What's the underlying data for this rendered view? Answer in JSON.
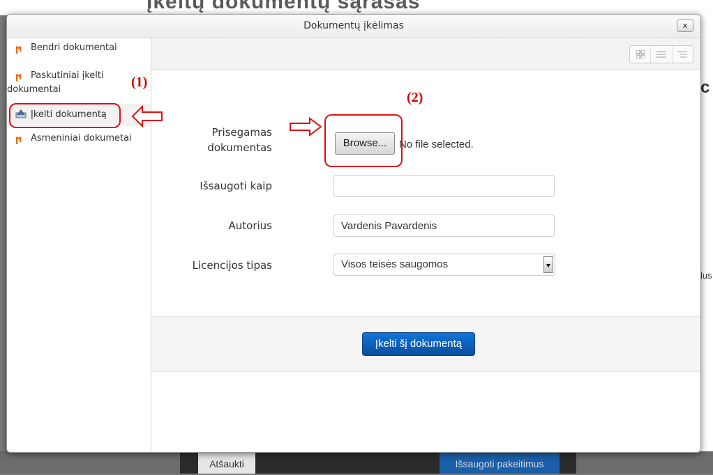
{
  "background": {
    "top_heading": "Įkeltų dokumentų sąrašas",
    "right_fragment_1": "c",
    "right_fragment_2": "lus",
    "cancel_label": "Atšaukti",
    "save_label": "Išsaugoti pakeitimus"
  },
  "modal": {
    "title": "Dokumentų įkėlimas",
    "close_label": "x"
  },
  "sidebar": {
    "items": [
      {
        "label": "Bendri dokumentai",
        "icon": "moodle-icon"
      },
      {
        "label_line1": "Paskutiniai įkelti",
        "label_line2": "dokumentai",
        "icon": "moodle-icon"
      },
      {
        "label": "Įkelti dokumentą",
        "icon": "upload-icon",
        "active": true
      },
      {
        "label": "Asmeniniai dokumetai",
        "icon": "moodle-icon"
      }
    ]
  },
  "form": {
    "attachment_label_line1": "Prisegamas",
    "attachment_label_line2": "dokumentas",
    "browse_label": "Browse...",
    "no_file_text": "No file selected.",
    "save_as_label": "Išsaugoti kaip",
    "save_as_value": "",
    "author_label": "Autorius",
    "author_value": "Vardenis Pavardenis",
    "license_label": "Licencijos tipas",
    "license_value": "Visos teisės saugomos",
    "upload_button": "Įkelti šį dokumentą"
  },
  "annotations": {
    "marker_1": "(1)",
    "marker_2": "(2)",
    "color": "#cc0000"
  },
  "colors": {
    "primary_button": "#0f6cc6",
    "moodle_icon": "#e86c12"
  }
}
